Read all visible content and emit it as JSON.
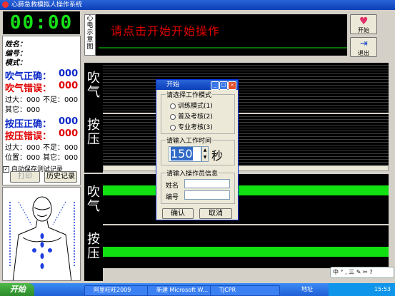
{
  "window": {
    "title": "心肺急救模拟人操作系统"
  },
  "timer": {
    "display": "00:00"
  },
  "info": {
    "name_label": "姓名：",
    "id_label": "编号：",
    "mode_label": "模式：",
    "blow_correct_label": "吹气正确：",
    "blow_correct_value": "000",
    "blow_wrong_label": "吹气错误：",
    "blow_wrong_value": "000",
    "blow_too_big": "过大：000",
    "blow_too_small": "不足：000",
    "blow_other": "其它：000",
    "press_correct_label": "按压正确：",
    "press_correct_value": "000",
    "press_wrong_label": "按压错误：",
    "press_wrong_value": "000",
    "press_too_big": "过大：000",
    "press_too_small": "不足：000",
    "press_position": "位置：000",
    "press_other": "其它：000"
  },
  "controls": {
    "autosave_label": "自动保存测试记录",
    "autosave_checked": true,
    "print_label": "打印",
    "history_label": "历史记录"
  },
  "ecg": {
    "side_label": "心电示意图",
    "message": "请点击开始开始操作"
  },
  "buttons": {
    "start_label": "开始",
    "exit_label": "退出"
  },
  "panels": {
    "blow_label": "吹气",
    "press_label": "按压",
    "blow_label_2": "吹气",
    "press_label_2": "按压"
  },
  "dialog": {
    "title": "开始",
    "mode_group_title": "请选择工作模式",
    "modes": [
      "训练模式(1)",
      "普及考核(2)",
      "专业考核(3)"
    ],
    "time_group_title": "请输入工作时间",
    "time_value": "150",
    "time_unit": "秒",
    "operator_group_title": "请输入操作员信息",
    "name_label": "姓名",
    "id_label": "编号",
    "ok_label": "确认",
    "cancel_label": "取消"
  },
  "ime": {
    "text": "中 ° , 三 ✎ ✂ ?"
  },
  "taskbar": {
    "start_label": "开始",
    "tasks": [
      "阿里旺旺2009",
      "新建 Microsoft W...",
      "TJCPR"
    ],
    "tray_label": "地址",
    "clock": "15:53"
  },
  "colors": {
    "accent_blue": "#0b28c8",
    "accent_red": "#e00000",
    "timer_green": "#16e016",
    "wave_green": "#11e011"
  }
}
